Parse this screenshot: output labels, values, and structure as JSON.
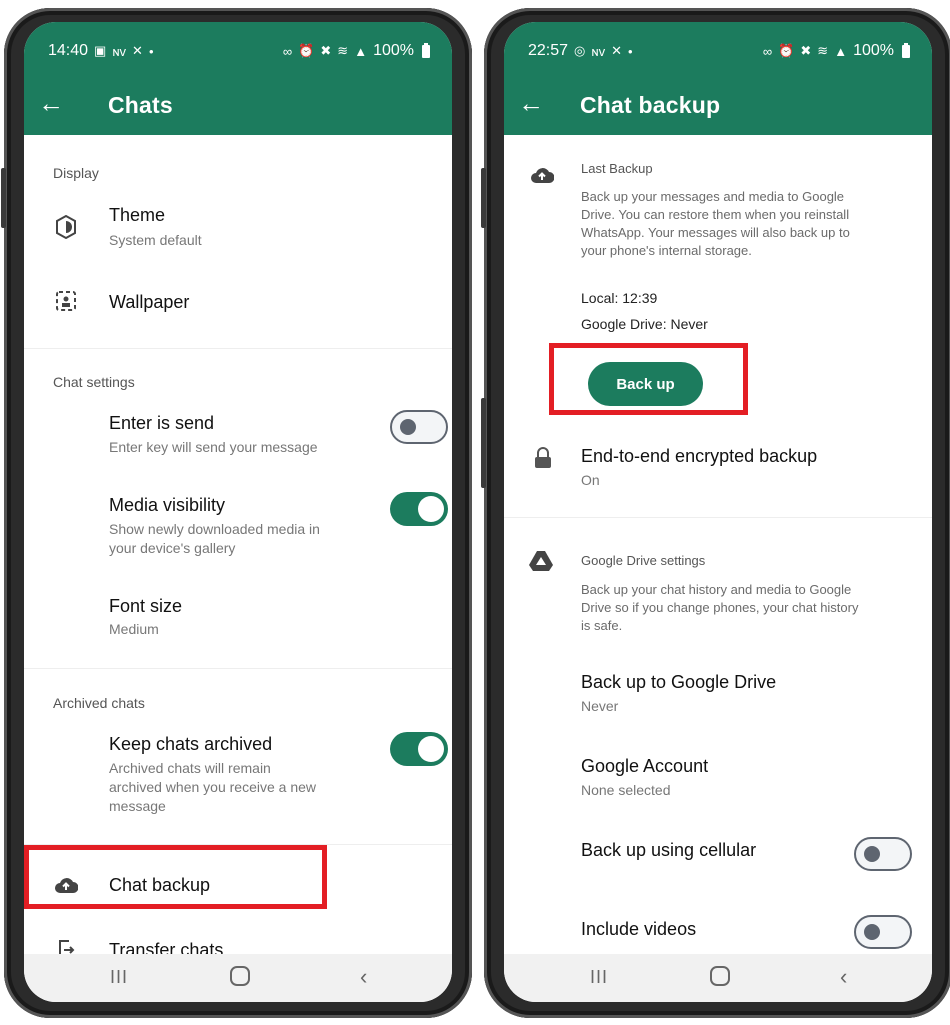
{
  "left_screen": {
    "status": {
      "time": "14:40",
      "battery": "100%"
    },
    "title": "Chats",
    "sections": {
      "display": "Display",
      "chat_settings": "Chat settings",
      "archived": "Archived chats"
    },
    "items": {
      "theme": {
        "title": "Theme",
        "sub": "System default"
      },
      "wallpaper": {
        "title": "Wallpaper"
      },
      "enter_send": {
        "title": "Enter is send",
        "sub": "Enter key will send your message",
        "on": false
      },
      "media_vis": {
        "title": "Media visibility",
        "sub1": "Show newly downloaded media in",
        "sub2": "your device's gallery",
        "on": true
      },
      "font_size": {
        "title": "Font size",
        "sub": "Medium"
      },
      "keep_archived": {
        "title": "Keep chats archived",
        "sub1": "Archived chats will remain",
        "sub2": "archived when you receive a new",
        "sub3": "message",
        "on": true
      },
      "chat_backup": {
        "title": "Chat backup"
      },
      "transfer": {
        "title": "Transfer chats"
      }
    }
  },
  "right_screen": {
    "status": {
      "time": "22:57",
      "battery": "100%"
    },
    "title": "Chat backup",
    "last_backup": {
      "header": "Last Backup",
      "desc1": "Back up your messages and media to Google",
      "desc2": "Drive. You can restore them when you reinstall",
      "desc3": "WhatsApp. Your messages will also back up to",
      "desc4": "your phone's internal storage.",
      "local": "Local: 12:39",
      "drive": "Google Drive: Never",
      "button": "Back up"
    },
    "e2e": {
      "title": "End-to-end encrypted backup",
      "sub": "On"
    },
    "drive_settings": {
      "header": "Google Drive settings",
      "desc1": "Back up your chat history and media to Google",
      "desc2": "Drive so if you change phones, your chat history",
      "desc3": "is safe."
    },
    "items": {
      "backup_drive": {
        "title": "Back up to Google Drive",
        "sub": "Never"
      },
      "account": {
        "title": "Google Account",
        "sub": "None selected"
      },
      "cellular": {
        "title": "Back up using cellular",
        "on": false
      },
      "videos": {
        "title": "Include videos",
        "on": false
      }
    }
  },
  "colors": {
    "brand": "#1c7c5e",
    "highlight": "#e31e24"
  },
  "icons": [
    "arrow-back-icon",
    "theme-icon",
    "wallpaper-icon",
    "cloud-upload-icon",
    "transfer-icon",
    "lock-icon",
    "google-drive-icon"
  ]
}
